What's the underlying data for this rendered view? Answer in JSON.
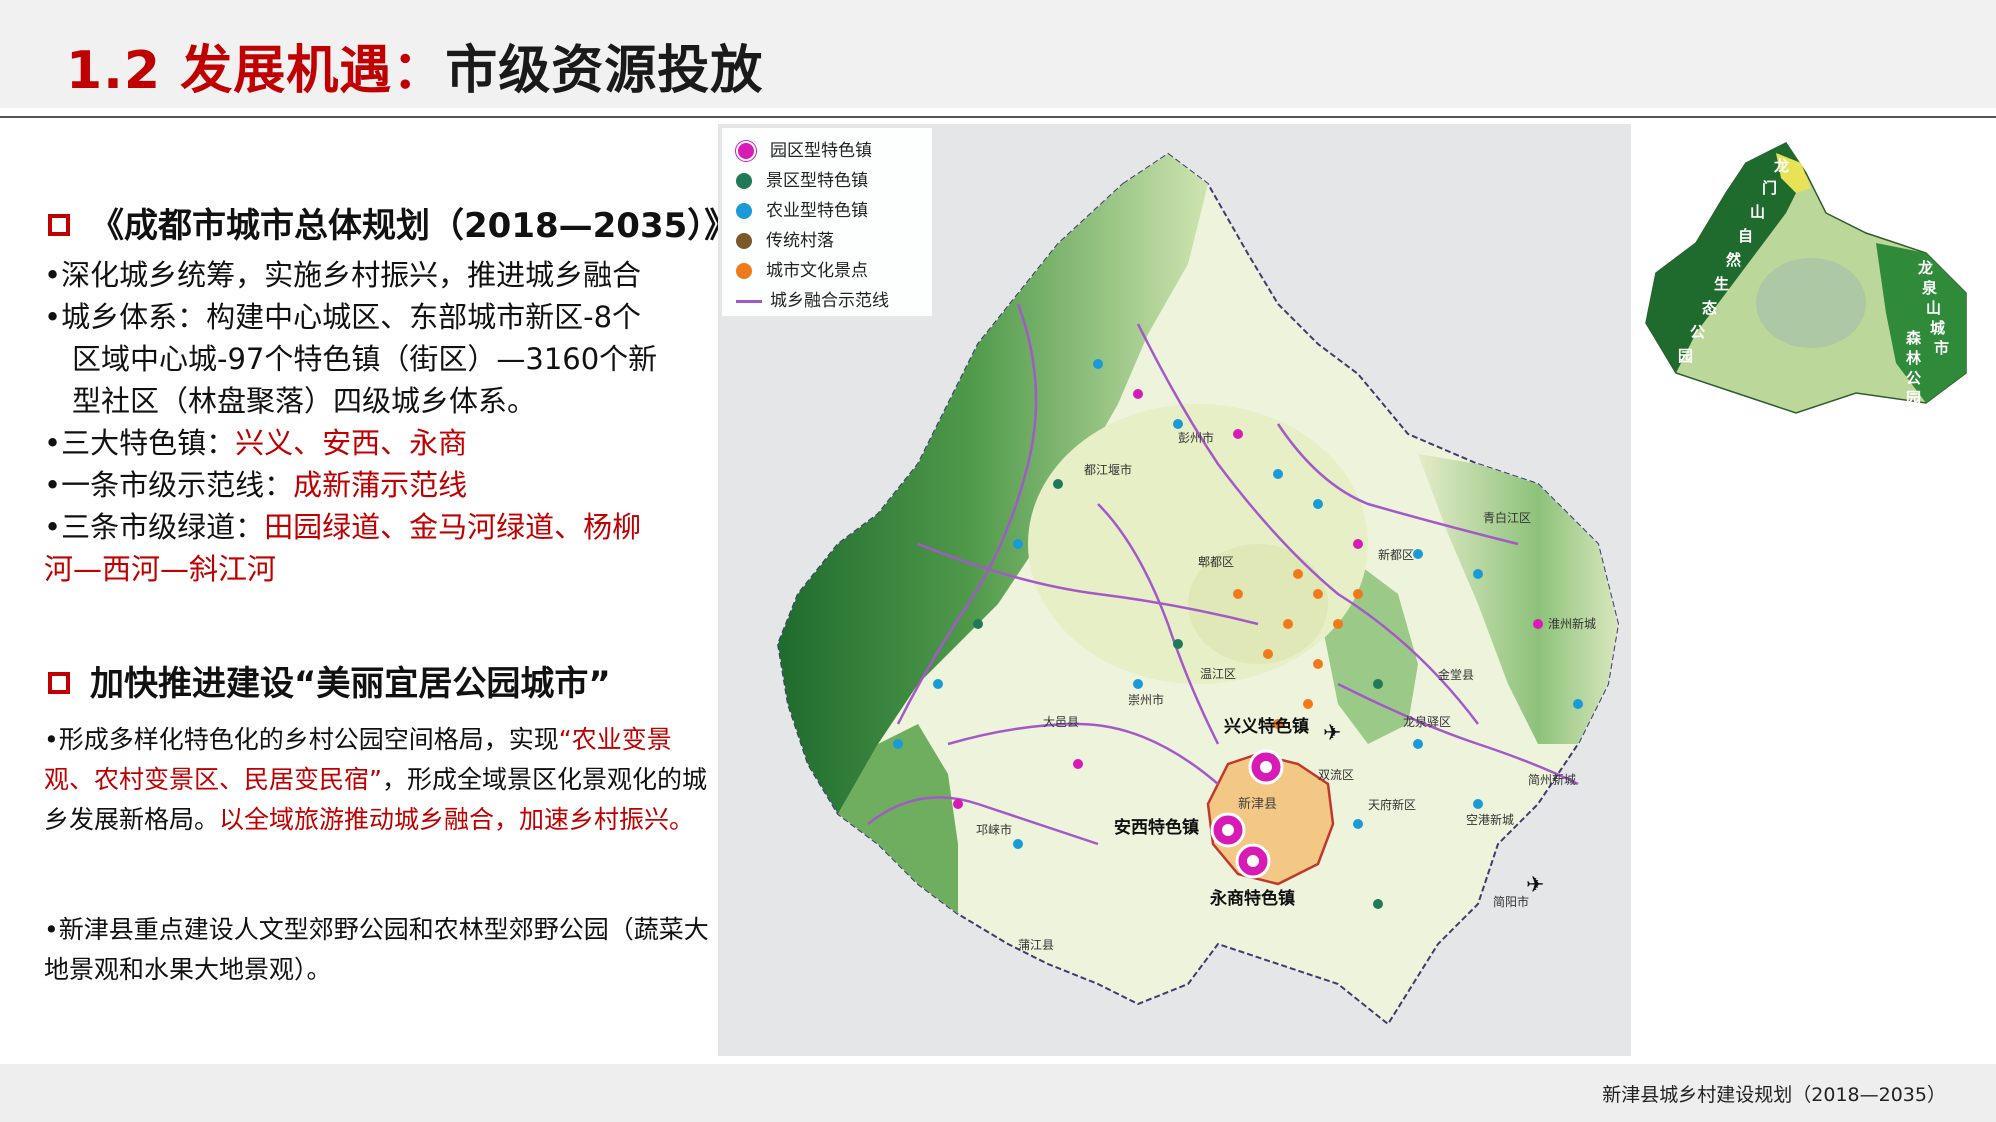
{
  "title": {
    "number": "1.2",
    "highlight": "发展机遇：",
    "rest": "市级资源投放"
  },
  "section1": {
    "heading": "《成都市城市总体规划（2018—2035）》",
    "b1": "•深化城乡统筹，实施乡村振兴，推进城乡融合",
    "b2_l1": "•城乡体系：构建中心城区、东部城市新区-8个",
    "b2_l2": "区域中心城-97个特色镇（街区）—3160个新",
    "b2_l3": "型社区（林盘聚落）四级城乡体系。",
    "b3_label": "•三大特色镇：",
    "b3_value": "兴义、安西、永商",
    "b4_label": "•一条市级示范线：",
    "b4_value": "成新蒲示范线",
    "b5_label": "•三条市级绿道：",
    "b5_value_l1": "田园绿道、金马河绿道、杨柳",
    "b5_value_l2": "河—西河—斜江河"
  },
  "section2": {
    "heading": "加快推进建设“美丽宜居公园城市”",
    "p1_a": "•形成多样化特色化的乡村公园空间格局，实现",
    "p1_red1": "“农业变景观、农村变景区、民居变民宿”",
    "p1_b": "，形成全域景区化景观化的城乡发展新格局。",
    "p1_red2": "以全域旅游推动城乡融合，加速乡村振兴。",
    "p2": "•新津县重点建设人文型郊野公园和农林型郊野公园（蔬菜大地景观和水果大地景观）。"
  },
  "legend": {
    "items": [
      {
        "label": "园区型特色镇",
        "color": "#d81bb5"
      },
      {
        "label": "景区型特色镇",
        "color": "#1f7a5a"
      },
      {
        "label": "农业型特色镇",
        "color": "#1a9bd7"
      },
      {
        "label": "传统村落",
        "color": "#7a5a2a"
      },
      {
        "label": "城市文化景点",
        "color": "#f07a1a"
      },
      {
        "label": "城乡融合示范线",
        "color": "#a359c8"
      }
    ]
  },
  "map": {
    "labels": {
      "xingyi": "兴义特色镇",
      "anxi": "安西特色镇",
      "yongshang": "永商特色镇",
      "xinjin": "新津县",
      "pengzhou": "彭州市",
      "qionglai": "邛崃市",
      "dayi": "大邑县",
      "chongzhou": "崇州市",
      "pujiang": "蒲江县",
      "jianyang": "简阳市",
      "kongang": "空港新城",
      "huaizhou": "淮州新城",
      "longquan": "龙泉驿区",
      "jintang": "金堂县",
      "xindu": "新都区",
      "pidu": "郫都区",
      "wenjiang": "温江区",
      "shuangliu": "双流区",
      "tianfu": "天府新区",
      "dujiangyan": "都江堰市",
      "qingbaijiang": "青白江区",
      "jianzhou": "简州新城"
    }
  },
  "inset": {
    "labels": [
      "龙",
      "门",
      "山",
      "自",
      "然",
      "生",
      "态",
      "公",
      "园",
      "龙",
      "泉",
      "山",
      "城",
      "市",
      "森",
      "林",
      "公",
      "园"
    ]
  },
  "footer": {
    "text": "新津县城乡村建设规划（2018—2035）"
  }
}
